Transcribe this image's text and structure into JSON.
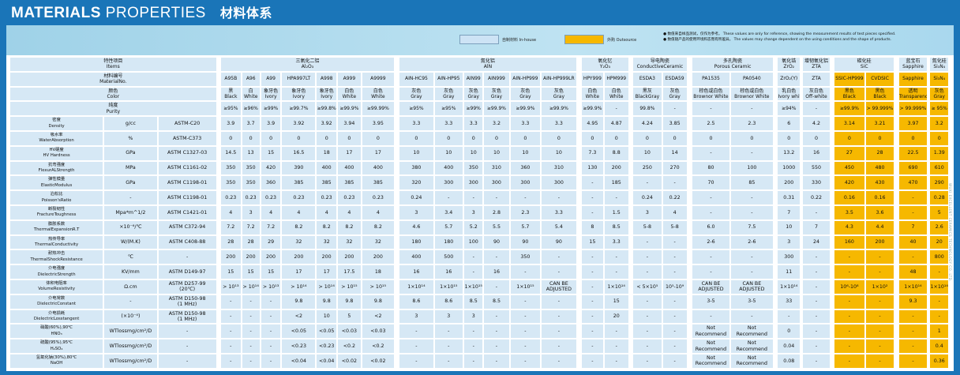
{
  "title": {
    "main": "MATERIALS",
    "light": "PROPERTIES",
    "cn": "材料体系"
  },
  "legend": {
    "inhouse": "自制材料 In-house",
    "outsource": "外购 Outsource",
    "inhouse_color": "#cde3f5",
    "outsource_color": "#f6b800"
  },
  "notes": [
    "● 数值来自样品测试，仅作为参考。 These values are only for reference, showing the measurement results of test pieces specified.",
    "● 数值随产品的使用环境和态而有所差异。 The values may change dependent on the using conditions and the shape of products."
  ],
  "side_text": "WUXI EXCELLENT CERAMICS TECHNOLOGY CO.,LTD.",
  "table": {
    "groups": [
      {
        "label": "特性项目",
        "sub": "Items",
        "span": 3
      },
      {
        "label": "三氧化二铝",
        "sub": "Al₂O₃",
        "span": 7
      },
      {
        "label": "氮化铝",
        "sub": "AlN",
        "span": 6
      },
      {
        "label": "氧化钇",
        "sub": "Y₂O₃",
        "span": 2
      },
      {
        "label": "导电陶瓷",
        "sub": "ConductiveCeramic",
        "span": 2
      },
      {
        "label": "多孔陶瓷",
        "sub": "Porous Ceramic",
        "span": 2
      },
      {
        "label": "氧化锆",
        "sub": "ZrO₂",
        "span": 1
      },
      {
        "label": "增韧氧化铝",
        "sub": "ZTA",
        "span": 1
      },
      {
        "label": "碳化硅",
        "sub": "SiC",
        "span": 2
      },
      {
        "label": "蓝宝石",
        "sub": "Sapphire",
        "span": 1
      },
      {
        "label": "氮化硅",
        "sub": "Si₃N₄",
        "span": 1
      }
    ],
    "material_label": [
      "材料编号",
      "MaterialNo."
    ],
    "materials": [
      "A95B",
      "A96",
      "A99",
      "HPA997LT",
      "A998",
      "A999",
      "A9999",
      "AIN-HC95",
      "AIN-HP95",
      "AIN99",
      "AIN999",
      "AIN-HP999",
      "AIN-HP999LR",
      "HPY999",
      "HPM999",
      "ESDA3",
      "ESDA59",
      "PA1535",
      "PA0540",
      "ZrO₂(Y)",
      "ZTA",
      "SSIC-HP999",
      "CVDSIC",
      "Sapphire",
      "Si₃N₄"
    ],
    "color_label": [
      "颜色",
      "Color"
    ],
    "colors": [
      [
        "黑",
        "Black"
      ],
      [
        "白",
        "White"
      ],
      [
        "象牙色",
        "Ivory"
      ],
      [
        "象牙色",
        "Ivory"
      ],
      [
        "象牙色",
        "Ivory"
      ],
      [
        "白色",
        "White"
      ],
      [
        "白色",
        "White"
      ],
      [
        "灰色",
        "Gray"
      ],
      [
        "灰色",
        "Gray"
      ],
      [
        "灰色",
        "Gray"
      ],
      [
        "灰色",
        "Gray"
      ],
      [
        "灰色",
        "Gray"
      ],
      [
        "灰色",
        "Gray"
      ],
      [
        "白色",
        "White"
      ],
      [
        "白色",
        "White"
      ],
      [
        "黑灰",
        "BlackGray"
      ],
      [
        "灰色",
        "Gray"
      ],
      [
        "棕色或白色",
        "Brownor White"
      ],
      [
        "棕色或白色",
        "Brownor White"
      ],
      [
        "乳白色",
        "Ivory white"
      ],
      [
        "灰白色",
        "Off-white"
      ],
      [
        "黑色",
        "Black"
      ],
      [
        "黑色",
        "Black"
      ],
      [
        "透明",
        "Transparency"
      ],
      [
        "灰色",
        "Gray"
      ]
    ],
    "purity_label": [
      "纯度",
      "Purity"
    ],
    "purity": [
      "≥95%",
      "≥96%",
      "≥99%",
      "≥99.7%",
      "≥99.8%",
      "≥99.9%",
      "≥99.99%",
      "≥95%",
      "≥95%",
      "≥99%",
      "≥99.9%",
      "≥99.9%",
      "≥99.9%",
      "≥99.9%",
      "-",
      "99.8%",
      "-",
      "-",
      "-",
      "≥94%",
      "-",
      "≥99.9%",
      "> 99.999%",
      "> 99.999%",
      "≥ 95%"
    ],
    "props": [
      {
        "cn": "密度",
        "en": "Density",
        "unit": "g/cc",
        "std": "ASTM-C20",
        "v": [
          "3.9",
          "3.7",
          "3.9",
          "3.92",
          "3.92",
          "3.94",
          "3.95",
          "3.3",
          "3.3",
          "3.3",
          "3.2",
          "3.3",
          "3.3",
          "4.95",
          "4.87",
          "4.24",
          "3.85",
          "2.5",
          "2.3",
          "6",
          "4.2",
          "3.14",
          "3.21",
          "3.97",
          "3.2"
        ]
      },
      {
        "cn": "吸水率",
        "en": "WaterAbsorption",
        "unit": "%",
        "std": "ASTM-C373",
        "v": [
          "0",
          "0",
          "0",
          "0",
          "0",
          "0",
          "0",
          "0",
          "0",
          "0",
          "0",
          "0",
          "0",
          "0",
          "0",
          "0",
          "0",
          "0",
          "0",
          "0",
          "0",
          "0",
          "0",
          "0",
          "0"
        ]
      },
      {
        "cn": "HV硬度",
        "en": "HV Hardness",
        "unit": "GPa",
        "std": "ASTM C1327-03",
        "v": [
          "14.5",
          "13",
          "15",
          "16.5",
          "18",
          "17",
          "17",
          "10",
          "10",
          "10",
          "10",
          "10",
          "10",
          "7.3",
          "8.8",
          "10",
          "14",
          "-",
          "-",
          "13.2",
          "16",
          "27",
          "28",
          "22.5",
          "1.39"
        ]
      },
      {
        "cn": "抗弯强度",
        "en": "FlexurALStrength",
        "unit": "MPa",
        "std": "ASTM C1161-02",
        "v": [
          "350",
          "350",
          "420",
          "390",
          "400",
          "400",
          "400",
          "380",
          "400",
          "350",
          "310",
          "360",
          "310",
          "130",
          "200",
          "250",
          "270",
          "80",
          "100",
          "1000",
          "550",
          "450",
          "480",
          "690",
          "610"
        ]
      },
      {
        "cn": "弹性模量",
        "en": "ElasticModulus",
        "unit": "GPa",
        "std": "ASTM C1198-01",
        "v": [
          "350",
          "350",
          "360",
          "385",
          "385",
          "385",
          "385",
          "320",
          "300",
          "300",
          "300",
          "300",
          "300",
          "-",
          "185",
          "-",
          "-",
          "70",
          "85",
          "200",
          "330",
          "420",
          "430",
          "470",
          "290"
        ]
      },
      {
        "cn": "泊松比",
        "en": "Poisson'sRatio",
        "unit": "-",
        "std": "ASTM C1198-01",
        "v": [
          "0.23",
          "0.23",
          "0.23",
          "0.23",
          "0.23",
          "0.23",
          "0.23",
          "0.24",
          "-",
          "-",
          "-",
          "-",
          "-",
          "-",
          "-",
          "0.24",
          "0.22",
          "-",
          "-",
          "0.31",
          "0.22",
          "0.16",
          "0.16",
          "-",
          "0.28"
        ]
      },
      {
        "cn": "断裂韧性",
        "en": "FractureToughness",
        "unit": "Mpa*m^1/2",
        "std": "ASTM C1421-01",
        "v": [
          "4",
          "3",
          "4",
          "4",
          "4",
          "4",
          "4",
          "3",
          "3.4",
          "3",
          "2.8",
          "2.3",
          "3.3",
          "-",
          "1.5",
          "3",
          "4",
          "-",
          "-",
          "7",
          "-",
          "3.5",
          "3.6",
          "-",
          "5"
        ]
      },
      {
        "cn": "膨胀系数",
        "en": "ThermalExpansionR.T",
        "unit": "×10⁻⁶/℃",
        "std": "ASTM C372-94",
        "v": [
          "7.2",
          "7.2",
          "7.2",
          "8.2",
          "8.2",
          "8.2",
          "8.2",
          "4.6",
          "5.7",
          "5.2",
          "5.5",
          "5.7",
          "5.4",
          "8",
          "8.5",
          "5-8",
          "5-8",
          "6.0",
          "7.5",
          "10",
          "7",
          "4.3",
          "4.4",
          "7",
          "2.6"
        ]
      },
      {
        "cn": "热传导率",
        "en": "ThermalConductivity",
        "unit": "W/(M.K)",
        "std": "ASTM C408-88",
        "v": [
          "28",
          "28",
          "29",
          "32",
          "32",
          "32",
          "32",
          "180",
          "180",
          "100",
          "90",
          "90",
          "90",
          "15",
          "3.3",
          "-",
          "-",
          "2-6",
          "2-6",
          "3",
          "24",
          "160",
          "200",
          "40",
          "20"
        ]
      },
      {
        "cn": "耐热冲击",
        "en": "ThermalShockResistance",
        "unit": "℃",
        "std": "-",
        "v": [
          "200",
          "200",
          "200",
          "200",
          "200",
          "200",
          "200",
          "400",
          "500",
          "-",
          "-",
          "350",
          "-",
          "-",
          "-",
          "-",
          "-",
          "-",
          "-",
          "300",
          "-",
          "-",
          "-",
          "-",
          "800"
        ]
      },
      {
        "cn": "介电强度",
        "en": "DielectricStrength",
        "unit": "KV/mm",
        "std": "ASTM D149-97",
        "v": [
          "15",
          "15",
          "15",
          "17",
          "17",
          "17.5",
          "18",
          "16",
          "16",
          "-",
          "16",
          "-",
          "-",
          "-",
          "-",
          "-",
          "-",
          "-",
          "-",
          "11",
          "-",
          "-",
          "-",
          "48",
          "-"
        ]
      },
      {
        "cn": "体积电阻率",
        "en": "VolumeResistivity",
        "unit": "Ω.cm",
        "std": "ASTM D257-99 (20℃)",
        "v": [
          "> 10¹³",
          "> 10¹⁴",
          "> 10¹³",
          "> 10¹⁴",
          "> 10¹⁴",
          "> 10¹⁵",
          "> 10¹⁵",
          "1×10¹⁴",
          "1×10¹⁵",
          "1×10¹⁵",
          "-",
          "1×10¹⁵",
          "CAN BE ADJUSTED",
          "-",
          "1×10¹⁴",
          "< 5×10⁵",
          "10⁵-10⁹",
          "CAN BE ADJUSTED",
          "CAN BE ADJUSTED",
          "1×10¹⁴",
          "-",
          "10⁶-10⁸",
          "1×10²",
          "1×10¹⁴",
          "1×10¹⁴"
        ]
      },
      {
        "cn": "介电常数",
        "en": "DielectricConstant",
        "unit": "-",
        "std": "ASTM D150-98 (1 MHz)",
        "v": [
          "-",
          "-",
          "-",
          "9.8",
          "9.8",
          "9.8",
          "9.8",
          "8.6",
          "8.6",
          "8.5",
          "8.5",
          "-",
          "-",
          "-",
          "15",
          "-",
          "-",
          "3-5",
          "3-5",
          "33",
          "-",
          "-",
          "-",
          "9.3",
          "-"
        ]
      },
      {
        "cn": "介电损耗",
        "en": "DielectricLosstangent",
        "unit": "(×10⁻⁴)",
        "std": "ASTM D150-98 (1 MHz)",
        "v": [
          "-",
          "-",
          "-",
          "<2",
          "10",
          "5",
          "<2",
          "3",
          "3",
          "3",
          "-",
          "-",
          "-",
          "-",
          "20",
          "-",
          "-",
          "-",
          "-",
          "-",
          "-",
          "-",
          "-",
          "-",
          "-"
        ]
      },
      {
        "cn": "硝酸(60%),90℃",
        "en": "HNO₃",
        "unit": "WTlossmg/cm²/D",
        "std": "-",
        "v": [
          "-",
          "-",
          "-",
          "<0.05",
          "<0.05",
          "<0.03",
          "<0.03",
          "-",
          "-",
          "-",
          "-",
          "-",
          "-",
          "-",
          "-",
          "-",
          "-",
          "Not Recommend",
          "Not Recommend",
          "0",
          "-",
          "-",
          "-",
          "-",
          "1"
        ]
      },
      {
        "cn": "硫酸(95%),95℃",
        "en": "H₂SO₄",
        "unit": "WTlossmg/cm²/D",
        "std": "-",
        "v": [
          "-",
          "-",
          "-",
          "<0.23",
          "<0.23",
          "<0.2",
          "<0.2",
          "-",
          "-",
          "-",
          "-",
          "-",
          "-",
          "-",
          "-",
          "-",
          "-",
          "Not Recommend",
          "Not Recommend",
          "0.04",
          "-",
          "-",
          "-",
          "-",
          "0.4"
        ]
      },
      {
        "cn": "氢氧化钠(30%),80℃",
        "en": "NaOH",
        "unit": "WTlossmg/cm²/D",
        "std": "-",
        "v": [
          "-",
          "-",
          "-",
          "<0.04",
          "<0.04",
          "<0.02",
          "<0.02",
          "-",
          "-",
          "-",
          "-",
          "-",
          "-",
          "-",
          "-",
          "-",
          "-",
          "Not Recommend",
          "Not Recommend",
          "0.08",
          "-",
          "-",
          "-",
          "-",
          "0.36"
        ]
      }
    ]
  }
}
